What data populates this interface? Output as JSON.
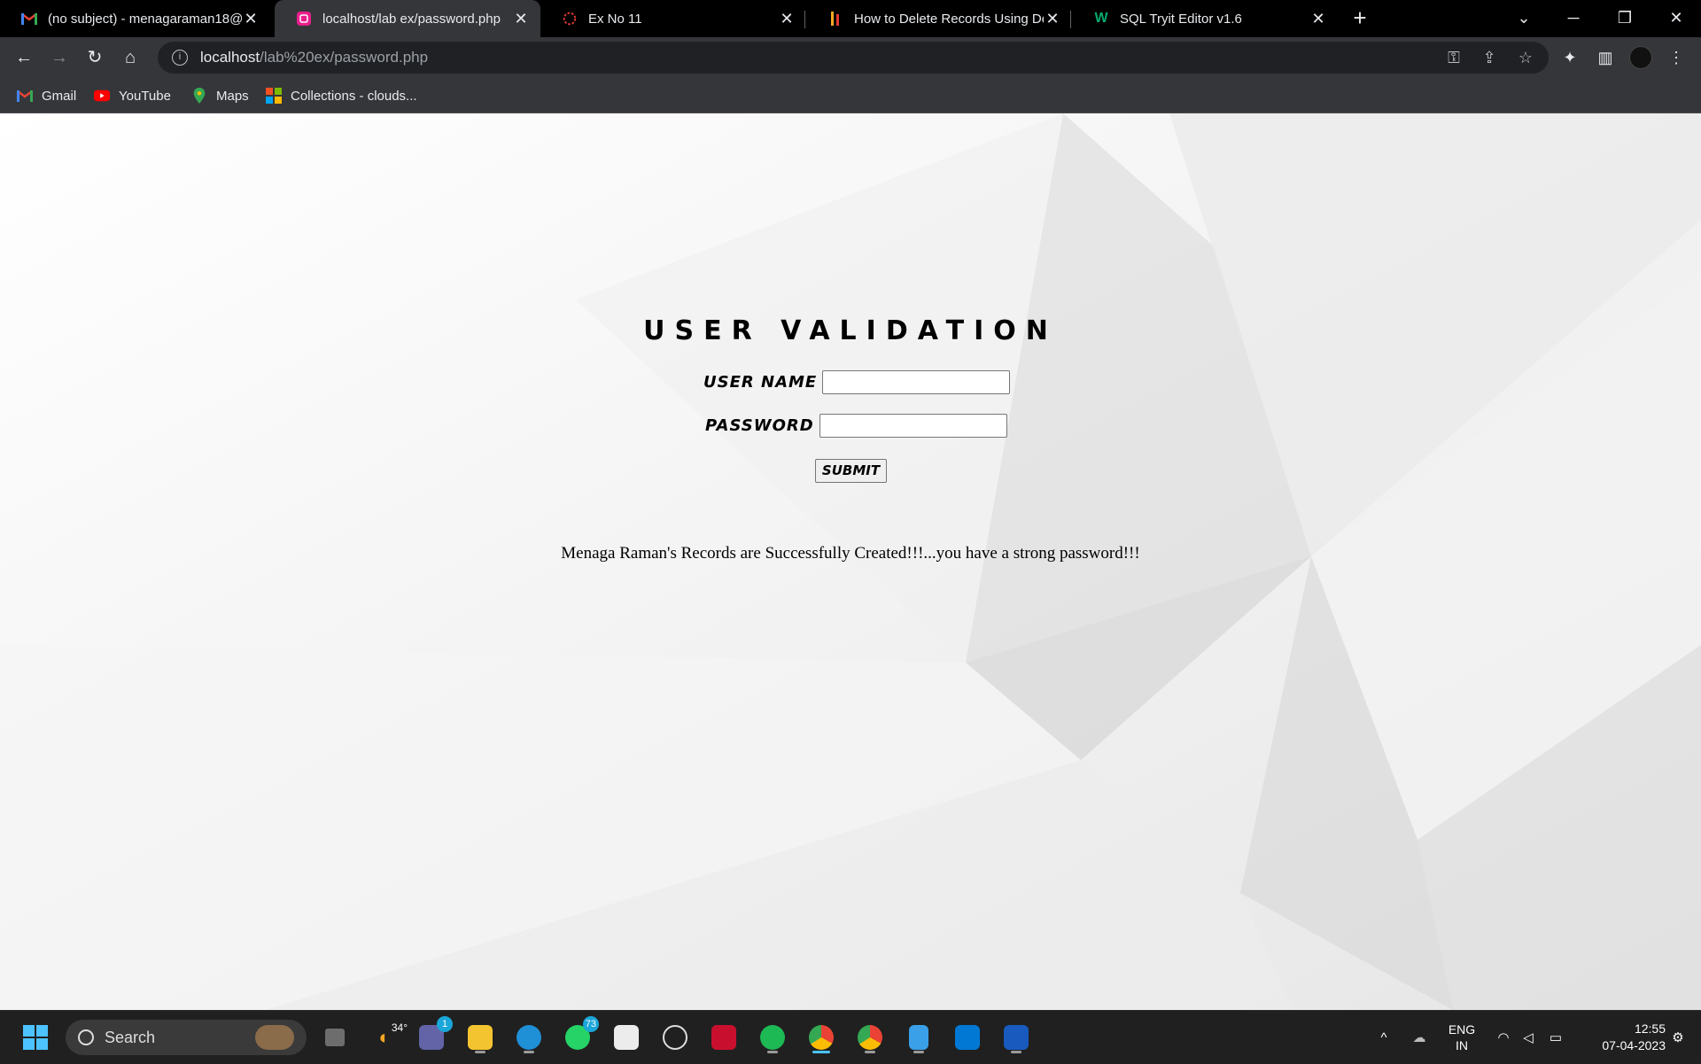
{
  "browser": {
    "tabs": [
      {
        "title": "(no subject) - menagaraman18@",
        "favicon": "gmail-icon",
        "active": false
      },
      {
        "title": "localhost/lab ex/password.php",
        "favicon": "php-icon",
        "active": true
      },
      {
        "title": "Ex No 11",
        "favicon": "ex-no-11-icon",
        "active": false
      },
      {
        "title": "How to Delete Records Using Del",
        "favicon": "article-icon",
        "active": false
      },
      {
        "title": "SQL Tryit Editor v1.6",
        "favicon": "w3schools-icon",
        "active": false
      }
    ],
    "address": {
      "host": "localhost",
      "path": "/lab%20ex/password.php"
    },
    "bookmarks": [
      {
        "label": "Gmail",
        "icon": "gmail-icon"
      },
      {
        "label": "YouTube",
        "icon": "youtube-icon"
      },
      {
        "label": "Maps",
        "icon": "maps-icon"
      },
      {
        "label": "Collections - clouds...",
        "icon": "collections-icon"
      }
    ]
  },
  "page": {
    "heading": "USER VALIDATION",
    "username_label": "USER NAME",
    "username_value": "",
    "password_label": "PASSWORD",
    "password_value": "",
    "submit_label": "SUBMIT",
    "message": "Menaga Raman's Records are Successfully Created!!!...you have a strong password!!!"
  },
  "taskbar": {
    "search_placeholder": "Search",
    "weather_temp": "34°",
    "teams_badge": "1",
    "whatsapp_badge": "73",
    "language_line1": "ENG",
    "language_line2": "IN",
    "time": "12:55",
    "date": "07-04-2023"
  },
  "colors": {
    "tab_bg": "#000000",
    "toolbar_bg": "#35363a",
    "taskbar_bg": "#202020",
    "accent": "#4cc2ff"
  }
}
